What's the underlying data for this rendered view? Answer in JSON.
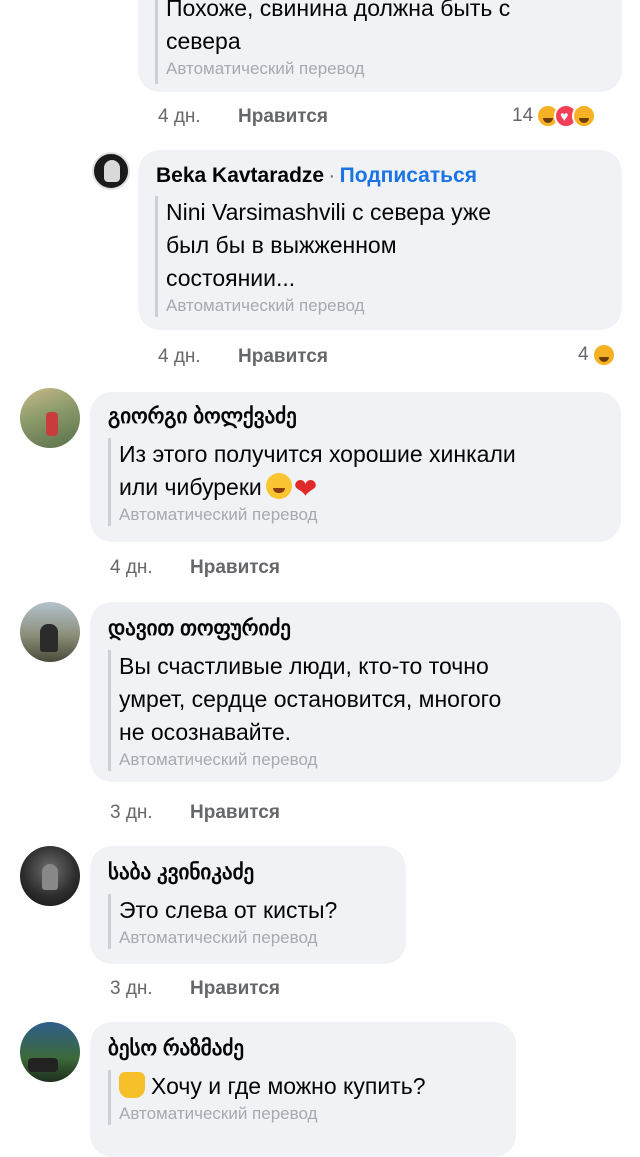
{
  "translation_label": "Автоматический перевод",
  "like_label": "Нравится",
  "comments": [
    {
      "id": "c1",
      "text_lines": [
        "Похоже, свинина должна быть с",
        "севера"
      ],
      "time": "4 дн.",
      "reactions_count": "14"
    },
    {
      "id": "c2",
      "author": "Beka Kavtaradze",
      "follow": "Подписаться",
      "dot": "·",
      "text_lines": [
        "Nini Varsimashvili с севера уже",
        "был бы в выжженном",
        "состоянии..."
      ],
      "time": "4 дн.",
      "reactions_count": "4"
    },
    {
      "id": "c3",
      "author": "გიორგი ბოლქვაძე",
      "text_lines": [
        "Из этого получится хорошие хинкали",
        "или чибуреки"
      ],
      "time": "4 дн."
    },
    {
      "id": "c4",
      "author": "დავით თოფურიძე",
      "text_lines": [
        "Вы счастливые люди, кто-то точно",
        "умрет, сердце остановится, многого",
        "не осознавайте."
      ],
      "time": "3 дн."
    },
    {
      "id": "c5",
      "author": "საბა კვინიკაძე",
      "text_lines": [
        "Это слева от кисты?"
      ],
      "time": "3 дн."
    },
    {
      "id": "c6",
      "author": "ბესო რაზმაძე",
      "text_lines": [
        "Хочу и где можно купить?"
      ]
    }
  ],
  "colors": {
    "bubble": "#f0f2f5",
    "follow": "#1b74e4",
    "meta": "#65676b",
    "translation": "#a6a9ae"
  }
}
